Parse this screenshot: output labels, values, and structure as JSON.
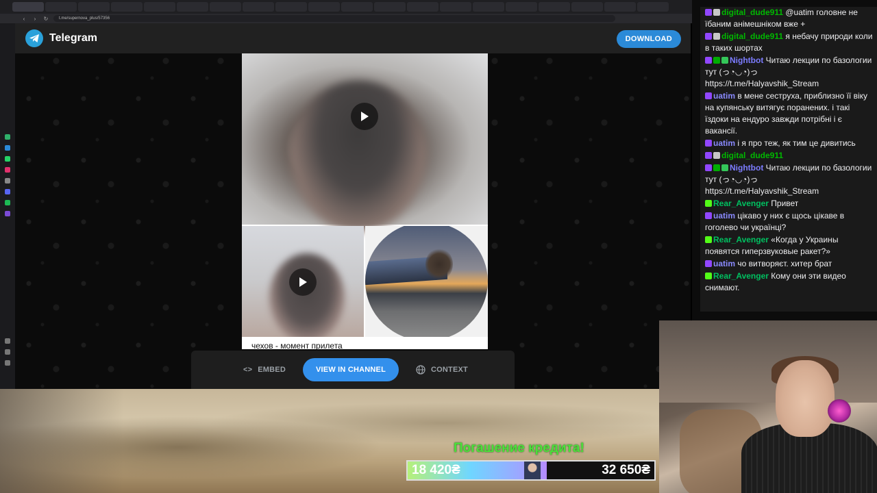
{
  "browser": {
    "tabs": [
      "",
      "",
      "",
      "",
      "",
      "",
      "",
      "",
      "",
      "",
      "",
      "",
      "",
      "",
      "",
      "",
      "",
      "",
      "",
      ""
    ],
    "url": "t.me/supernova_plus/57356"
  },
  "telegram": {
    "brand": "Telegram",
    "download_label": "DOWNLOAD",
    "caption": "чехов - момент прилета",
    "embed_label": "EMBED",
    "view_label": "VIEW IN CHANNEL",
    "context_label": "CONTEXT",
    "accent_color": "#3390ec"
  },
  "chat": {
    "messages": [
      {
        "user": "digital_dude911",
        "user_color": "#00b800",
        "text": "@uatim головне не їбаним анімешніком вже +",
        "badges": [
          "sub",
          "mute"
        ]
      },
      {
        "user": "digital_dude911",
        "user_color": "#00b800",
        "text": "я небачу природи коли в таких шортах",
        "badges": [
          "sub",
          "mute"
        ]
      },
      {
        "user": "Nightbot",
        "user_color": "#7c7cff",
        "text": "Читаю лекции по базологии тут (っ◔◡◔)っ https://t.me/Halyavshik_Stream",
        "badges": [
          "sub",
          "mod",
          "bot"
        ]
      },
      {
        "user": "uatim",
        "user_color": "#8a8aff",
        "text": "в мене сеструха, приблизно її віку на купянську витягує поранених. і такі їздоки на ендуро завжди потрібні і є вакансії.",
        "badges": [
          "sub"
        ]
      },
      {
        "user": "uatim",
        "user_color": "#8a8aff",
        "text": "і я про теж, як тим це дивитись",
        "badges": [
          "sub"
        ]
      },
      {
        "user": "digital_dude911",
        "user_color": "#00b800",
        "text": "",
        "badges": [
          "sub",
          "mute"
        ]
      },
      {
        "user": "Nightbot",
        "user_color": "#7c7cff",
        "text": "Читаю лекции по базологии тут (っ◔◡◔)っ https://t.me/Halyavshik_Stream",
        "badges": [
          "sub",
          "mod",
          "bot"
        ]
      },
      {
        "user": "Rear_Avenger",
        "user_color": "#00c060",
        "text": "Привет",
        "badges": [
          "kick"
        ]
      },
      {
        "user": "uatim",
        "user_color": "#8a8aff",
        "text": "цікаво у них є щось цікаве в гоголево чи українці?",
        "badges": [
          "sub"
        ]
      },
      {
        "user": "Rear_Avenger",
        "user_color": "#00c060",
        "text": "«Когда у Украины появятся гиперзвуковые ракет?»",
        "badges": [
          "kick"
        ]
      },
      {
        "user": "uatim",
        "user_color": "#8a8aff",
        "text": "чо витворяєт. хитер брат",
        "badges": [
          "sub"
        ]
      },
      {
        "user": "Rear_Avenger",
        "user_color": "#00c060",
        "text": "Кому они эти видео снимают.",
        "badges": [
          "kick"
        ]
      }
    ]
  },
  "overlay": {
    "goal_title": "Погашение кредита!",
    "current": "18 420₴",
    "goal": "32 650₴",
    "progress": 0.564
  }
}
